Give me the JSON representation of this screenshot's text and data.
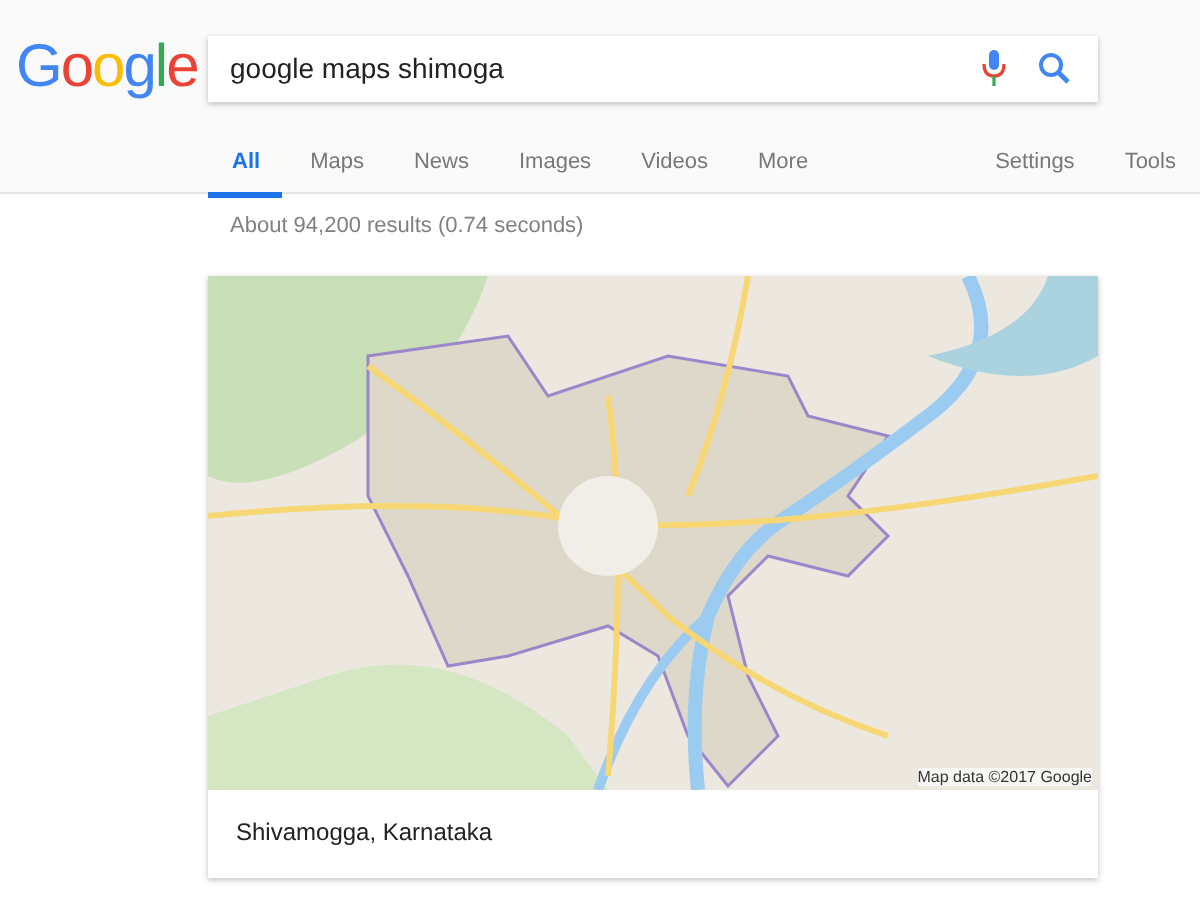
{
  "logo": "Google",
  "search": {
    "value": "google maps shimoga"
  },
  "tabs": [
    {
      "label": "All",
      "selected": true
    },
    {
      "label": "Maps",
      "selected": false
    },
    {
      "label": "News",
      "selected": false
    },
    {
      "label": "Images",
      "selected": false
    },
    {
      "label": "Videos",
      "selected": false
    },
    {
      "label": "More",
      "selected": false
    }
  ],
  "tools": [
    "Settings",
    "Tools"
  ],
  "result_stats": "About 94,200 results (0.74 seconds)",
  "map_card": {
    "map_attribution": "Map data ©2017 Google",
    "caption": "Shivamogga, Karnataka"
  }
}
